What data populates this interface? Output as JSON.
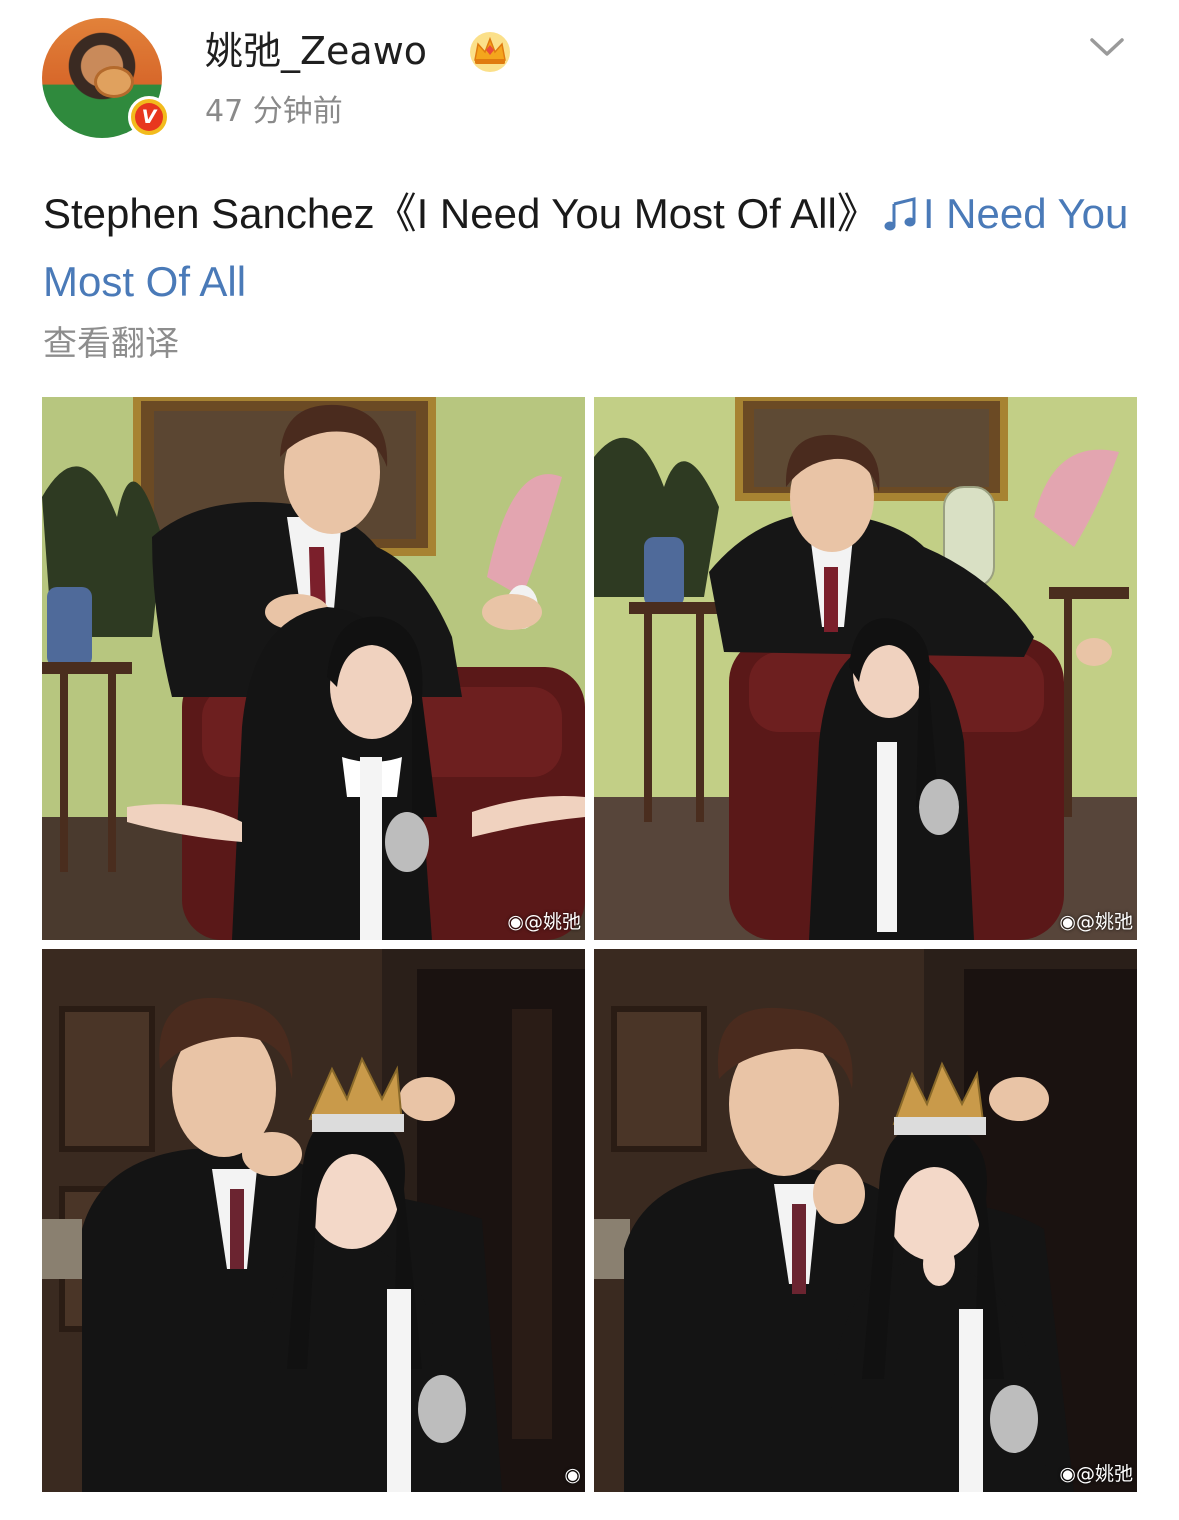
{
  "post": {
    "author": {
      "name": "姚弛_Zeawo",
      "verified_badge": "V",
      "time_ago": "47 分钟前"
    },
    "content": {
      "text_prefix": "Stephen Sanchez《I Need You Most Of All》",
      "music_link": "I Need You Most Of All"
    },
    "translate_label": "查看翻译",
    "photos": [
      {
        "watermark": "@姚弛"
      },
      {
        "watermark": "@姚弛"
      },
      {
        "watermark": ""
      },
      {
        "watermark": "@姚弛"
      }
    ]
  },
  "icons": {
    "member_badge": "crown-icon",
    "menu": "chevron-down-icon",
    "music": "music-note-icon",
    "watermark_logo": "weibo-logo-icon"
  },
  "colors": {
    "link": "#4a7ab8",
    "muted": "#8d8d8d",
    "badge_bg": "#f2bb1d",
    "badge_inner": "#e8371e"
  }
}
